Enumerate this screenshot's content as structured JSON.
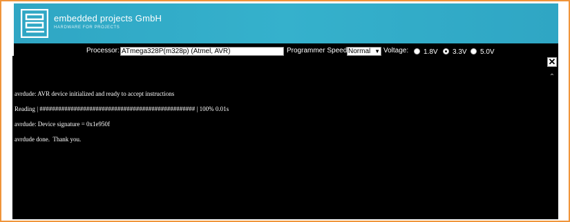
{
  "header": {
    "company": "embedded projects GmbH",
    "tagline": "HARDWARE FOR PROJECTS"
  },
  "toolbar": {
    "processor_label": "Processor:",
    "processor_value": "ATmega328P(m328p) (Atmel, AVR)",
    "speed_label": "Programmer Speed:",
    "speed_value": "Normal",
    "voltage_label": "Voltage:",
    "voltage_options": [
      "1.8V",
      "3.3V",
      "5.0V"
    ],
    "voltage_selected": "3.3V"
  },
  "console": {
    "close_icon": "close-icon",
    "lines": [
      "avrdude: AVR device initialized and ready to accept instructions",
      "Reading | ################################################## | 100% 0.01s",
      "avrdude: Device signature = 0x1e950f",
      "avrdude done.  Thank you."
    ]
  },
  "colors": {
    "frame": "#f0943a",
    "header": "#35b1cc",
    "console": "#000000"
  }
}
